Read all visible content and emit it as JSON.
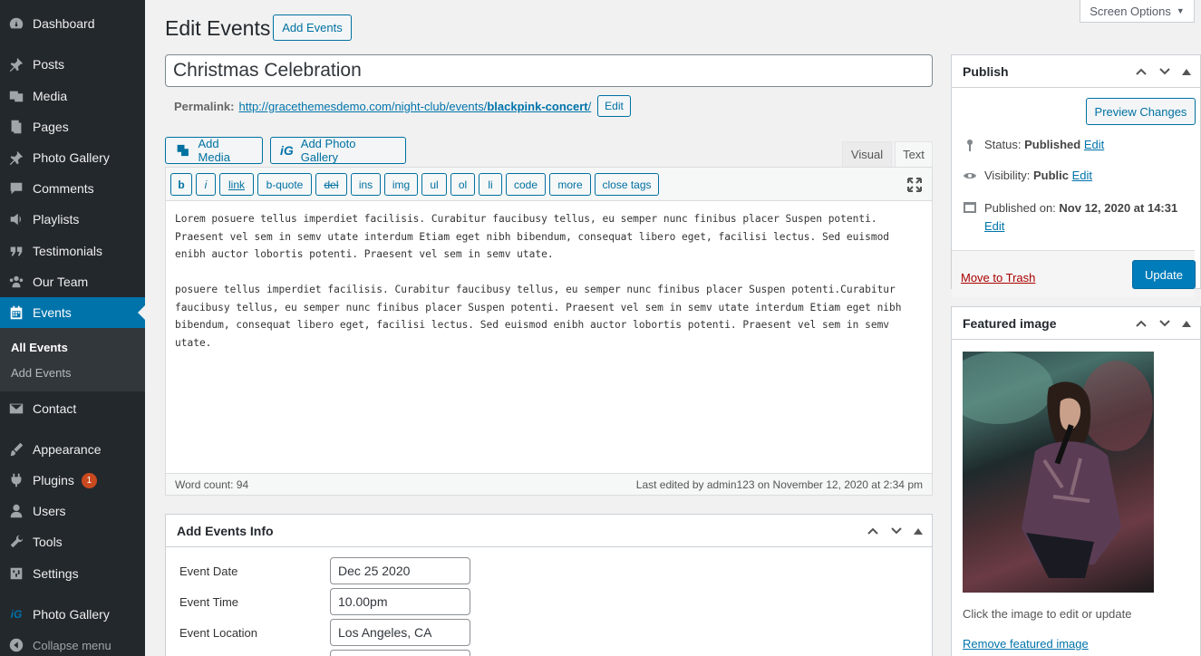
{
  "sidebar": {
    "items": [
      {
        "label": "Dashboard",
        "icon": "dashboard-icon"
      },
      {
        "label": "Posts",
        "icon": "pin-icon"
      },
      {
        "label": "Media",
        "icon": "media-icon"
      },
      {
        "label": "Pages",
        "icon": "pages-icon"
      },
      {
        "label": "Photo Gallery",
        "icon": "pin-icon"
      },
      {
        "label": "Comments",
        "icon": "comments-icon"
      },
      {
        "label": "Playlists",
        "icon": "audio-icon"
      },
      {
        "label": "Testimonials",
        "icon": "quote-icon"
      },
      {
        "label": "Our Team",
        "icon": "groups-icon"
      },
      {
        "label": "Events",
        "icon": "calendar-icon"
      },
      {
        "label": "Contact",
        "icon": "email-icon"
      },
      {
        "label": "Appearance",
        "icon": "brush-icon"
      },
      {
        "label": "Plugins",
        "icon": "plugin-icon",
        "badge": "1"
      },
      {
        "label": "Users",
        "icon": "users-icon"
      },
      {
        "label": "Tools",
        "icon": "wrench-icon"
      },
      {
        "label": "Settings",
        "icon": "settings-icon"
      },
      {
        "label": "Photo Gallery",
        "icon": "photo-gallery-logo-icon"
      }
    ],
    "submenu": [
      "All Events",
      "Add Events"
    ],
    "collapse_label": "Collapse menu"
  },
  "header": {
    "title": "Edit Events",
    "add_button": "Add Events",
    "screen_options": "Screen Options"
  },
  "post": {
    "title": "Christmas Celebration",
    "permalink_label": "Permalink:",
    "permalink_base": "http://gracethemesdemo.com/night-club/events/",
    "permalink_slug": "blackpink-concert",
    "permalink_edit": "Edit"
  },
  "editor": {
    "add_media": "Add Media",
    "add_gallery": "Add Photo Gallery",
    "tab_visual": "Visual",
    "tab_text": "Text",
    "quicktags": [
      "b",
      "i",
      "link",
      "b-quote",
      "del",
      "ins",
      "img",
      "ul",
      "ol",
      "li",
      "code",
      "more",
      "close tags"
    ],
    "paragraphs": [
      "Lorem posuere tellus imperdiet facilisis. Curabitur faucibusy tellus, eu semper nunc finibus placer Suspen potenti. Praesent vel sem in semv utate interdum Etiam eget nibh bibendum, consequat libero eget, facilisi lectus. Sed euismod enibh auctor lobortis potenti. Praesent vel sem in semv utate.",
      "posuere tellus imperdiet facilisis. Curabitur faucibusy tellus, eu semper nunc finibus placer Suspen potenti.Curabitur faucibusy tellus, eu semper nunc finibus placer Suspen potenti. Praesent vel sem in semv utate interdum Etiam eget nibh bibendum, consequat libero eget, facilisi lectus. Sed euismod enibh auctor lobortis potenti. Praesent vel sem in semv utate."
    ],
    "word_count": "Word count: 94",
    "last_edited": "Last edited by admin123 on November 12, 2020 at 2:34 pm"
  },
  "event_info": {
    "title": "Add Events Info",
    "fields": [
      {
        "label": "Event Date",
        "value": "Dec 25 2020"
      },
      {
        "label": "Event Time",
        "value": "10.00pm"
      },
      {
        "label": "Event Location",
        "value": "Los Angeles, CA"
      }
    ]
  },
  "publish": {
    "title": "Publish",
    "preview": "Preview Changes",
    "status_label": "Status:",
    "status_value": "Published",
    "visibility_label": "Visibility:",
    "visibility_value": "Public",
    "published_label": "Published on:",
    "published_value": "Nov 12, 2020 at 14:31",
    "edit": "Edit",
    "trash": "Move to Trash",
    "update": "Update"
  },
  "featured": {
    "title": "Featured image",
    "hint": "Click the image to edit or update",
    "remove": "Remove featured image"
  },
  "colors": {
    "accent": "#0073aa",
    "sidebar": "#23282d",
    "badge": "#ca4a1f"
  }
}
